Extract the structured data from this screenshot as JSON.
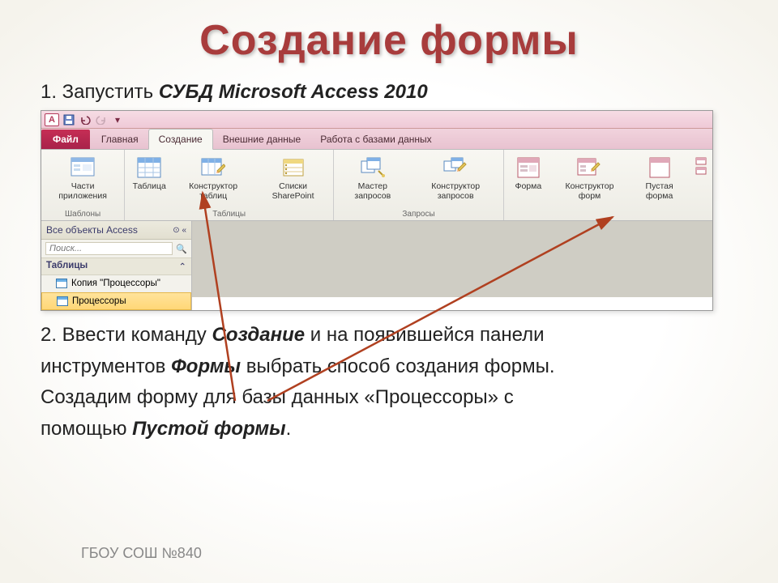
{
  "title": "Создание формы",
  "step1": {
    "prefix": "1. Запустить ",
    "bold": "СУБД Microsoft Access 2010"
  },
  "step2": {
    "l1a": "2. Ввести команду ",
    "l1b": "Создание",
    "l1c": " и на появившейся панели",
    "l2a": "инструментов ",
    "l2b": "Формы",
    "l2c": " выбрать способ создания формы.",
    "l3": "Создадим форму для базы данных «Процессоры» с",
    "l4a": "помощью ",
    "l4b": "Пустой формы",
    "l4c": "."
  },
  "footer": "ГБОУ СОШ №840",
  "app": {
    "qat_access": "A",
    "tabs": {
      "file": "Файл",
      "home": "Главная",
      "create": "Создание",
      "external": "Внешние данные",
      "dbtools": "Работа с базами данных"
    },
    "groups": {
      "templates": "Шаблоны",
      "tables": "Таблицы",
      "queries": "Запросы"
    },
    "buttons": {
      "app_parts": "Части приложения",
      "table": "Таблица",
      "table_design": "Конструктор таблиц",
      "sharepoint": "Списки SharePoint",
      "query_wiz": "Мастер запросов",
      "query_design": "Конструктор запросов",
      "form": "Форма",
      "form_design": "Конструктор форм",
      "blank_form": "Пустая форма"
    },
    "nav": {
      "header": "Все объекты Access",
      "search_placeholder": "Поиск...",
      "category": "Таблицы",
      "items": [
        "Копия \"Процессоры\"",
        "Процессоры"
      ]
    }
  }
}
